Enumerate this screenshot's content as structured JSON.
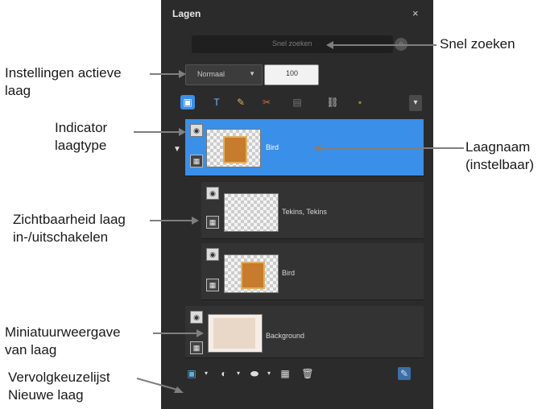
{
  "panel": {
    "title": "Lagen",
    "close_glyph": "×",
    "search": {
      "placeholder": "Snel zoeken",
      "icon": "search-icon"
    },
    "blend_mode": "Normaal",
    "opacity": "100",
    "toolbar_icons": [
      "new-raster-layer-icon",
      "new-vector-layer-icon",
      "new-art-media-layer-icon",
      "new-mask-icon",
      "layer-group-icon",
      "link-icon",
      "lock-icon"
    ],
    "layers": [
      {
        "name": "Bird",
        "selected": true
      },
      {
        "name": "Tekins, Tekins"
      },
      {
        "name": "Bird"
      },
      {
        "name": "Background"
      }
    ],
    "bottom_icons": [
      "new-layer-icon",
      "new-adjustment-layer-icon",
      "mask-icon",
      "merge-icon",
      "delete-icon",
      "properties-icon"
    ]
  },
  "annotations": {
    "snel_zoeken": "Snel zoeken",
    "instellingen_line1": "Instellingen actieve",
    "instellingen_line2": "laag",
    "indicator_line1": "Indicator",
    "indicator_line2": "laagtype",
    "laagnaam_line1": "Laagnaam",
    "laagnaam_line2": "(instelbaar)",
    "zichtbaarheid_line1": "Zichtbaarheid laag",
    "zichtbaarheid_line2": "in-/uitschakelen",
    "miniatuur_line1": "Miniatuurweergave",
    "miniatuur_line2": "van laag",
    "vervolg_line1": "Vervolgkeuzelijst",
    "vervolg_line2": "Nieuwe laag"
  },
  "colors": {
    "panel_bg": "#2b2b2b",
    "selected": "#3a8fe8",
    "annotation_arrow": "#7f7f7f"
  }
}
